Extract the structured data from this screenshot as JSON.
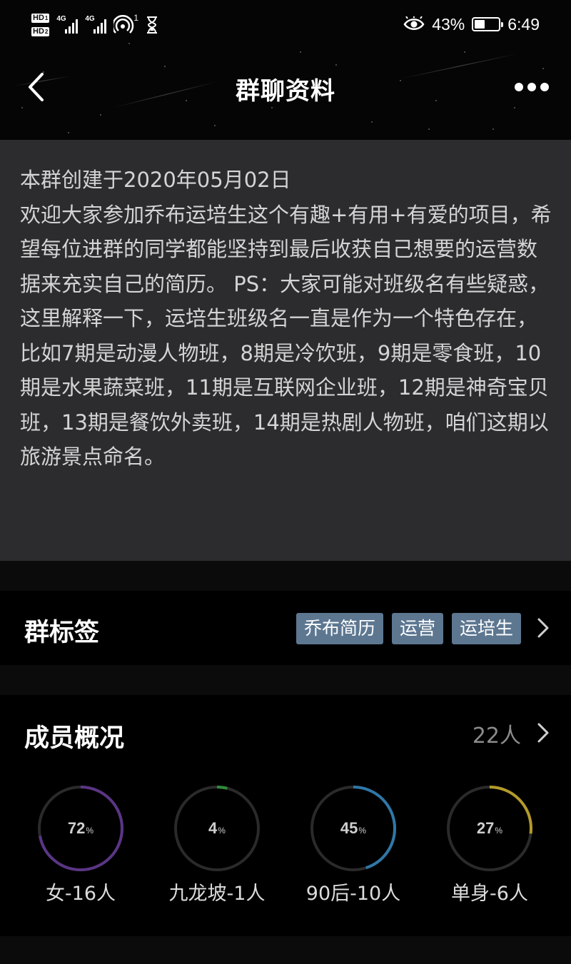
{
  "status_bar": {
    "hd_badges": [
      "HD",
      "HD"
    ],
    "hd_sub": [
      "1",
      "2"
    ],
    "network": [
      "4G",
      "4G"
    ],
    "hotspot_count": "1",
    "battery": "43%",
    "battery_level": 0.43,
    "time": "6:49"
  },
  "nav": {
    "title": "群聊资料"
  },
  "intro": {
    "created": "本群创建于2020年05月02日",
    "description": "欢迎大家参加乔布运培生这个有趣+有用+有爱的项目，希望每位进群的同学都能坚持到最后收获自己想要的运营数据来充实自己的简历。 PS：大家可能对班级名有些疑惑，这里解释一下，运培生班级名一直是作为一个特色存在，比如7期是动漫人物班，8期是冷饮班，9期是零食班，10期是水果蔬菜班，11期是互联网企业班，12期是神奇宝贝班，13期是餐饮外卖班，14期是热剧人物班，咱们这期以旅游景点命名。"
  },
  "tags": {
    "title": "群标签",
    "items": [
      "乔布简历",
      "运营",
      "运培生"
    ]
  },
  "members": {
    "title": "成员概况",
    "count": "22人",
    "stats": [
      {
        "percent": 72,
        "percent_text": "72",
        "unit": "%",
        "label": "女-16人",
        "color": "#5a3585"
      },
      {
        "percent": 4,
        "percent_text": "4",
        "unit": "%",
        "label": "九龙坡-1人",
        "color": "#2f8a3a"
      },
      {
        "percent": 45,
        "percent_text": "45",
        "unit": "%",
        "label": "90后-10人",
        "color": "#2f77a8"
      },
      {
        "percent": 27,
        "percent_text": "27",
        "unit": "%",
        "label": "单身-6人",
        "color": "#b49a2a"
      }
    ],
    "ring_track_color": "#2a2a2a"
  }
}
